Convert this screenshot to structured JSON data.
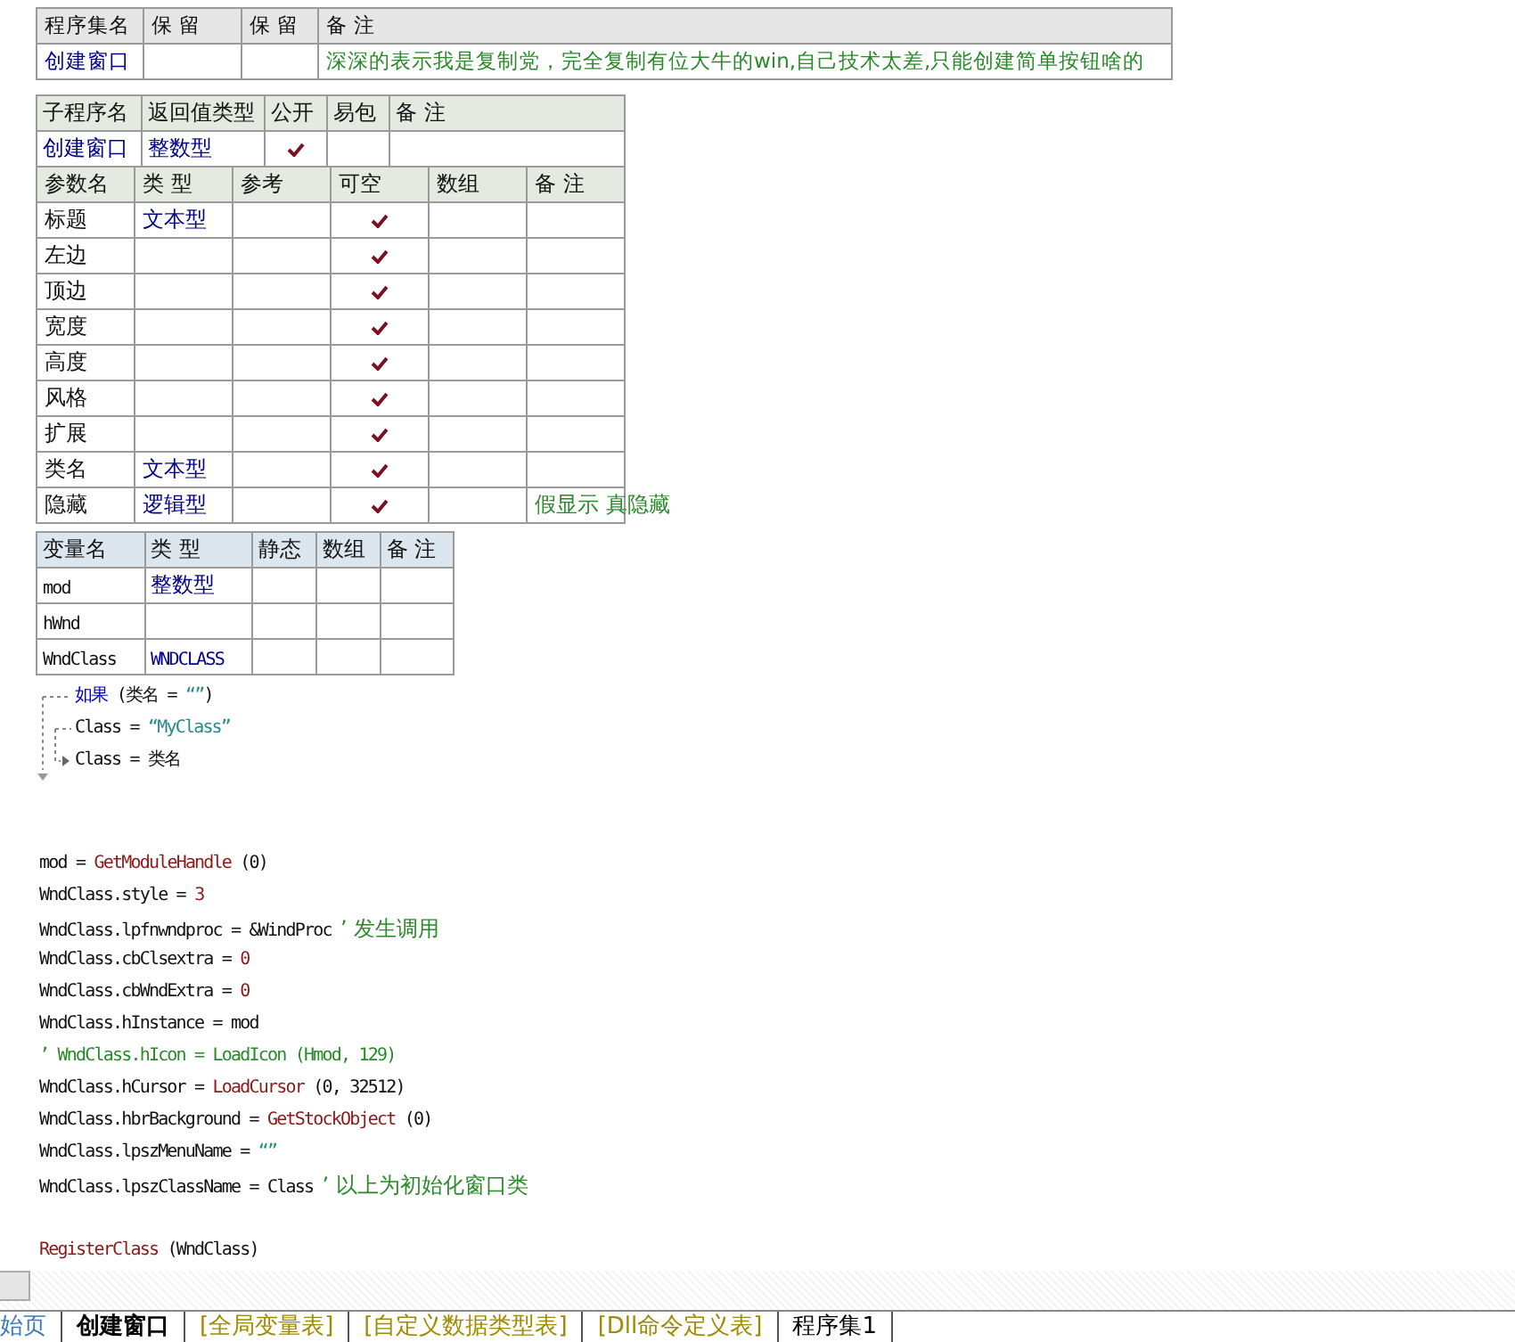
{
  "assembly_table": {
    "columns": [
      "程序集名",
      "保 留",
      "保 留",
      "备 注"
    ],
    "row": {
      "name": "创建窗口",
      "note": "深深的表示我是复制党，完全复制有位大牛的win,自己技术太差,只能创建简单按钮啥的"
    }
  },
  "subroutine_table": {
    "columns": [
      "子程序名",
      "返回值类型",
      "公开",
      "易包",
      "备 注"
    ],
    "row": {
      "name": "创建窗口",
      "return_type": "整数型",
      "public": true
    },
    "param_columns": [
      "参数名",
      "类 型",
      "参考",
      "可空",
      "数组",
      "备 注"
    ],
    "params": [
      {
        "name": "标题",
        "type": "文本型",
        "nullable": true
      },
      {
        "name": "左边",
        "nullable": true
      },
      {
        "name": "顶边",
        "nullable": true
      },
      {
        "name": "宽度",
        "nullable": true
      },
      {
        "name": "高度",
        "nullable": true
      },
      {
        "name": "风格",
        "nullable": true
      },
      {
        "name": "扩展",
        "nullable": true
      },
      {
        "name": "类名",
        "type": "文本型",
        "nullable": true
      },
      {
        "name": "隐藏",
        "type": "逻辑型",
        "nullable": true,
        "note": "假显示 真隐藏"
      }
    ]
  },
  "variable_table": {
    "columns": [
      "变量名",
      "类 型",
      "静态",
      "数组",
      "备 注"
    ],
    "rows": [
      {
        "name": "mod",
        "type": "整数型"
      },
      {
        "name": "hWnd"
      },
      {
        "name": "WndClass",
        "type": "WNDCLASS"
      }
    ]
  },
  "flow_block": [
    [
      {
        "kind": "keyword",
        "text": "如果"
      },
      {
        "kind": "plain",
        "text": " (类名 = "
      },
      {
        "kind": "str",
        "text": "“”"
      },
      {
        "kind": "plain",
        "text": ")"
      }
    ],
    [
      {
        "kind": "plain",
        "text": "Class = "
      },
      {
        "kind": "str",
        "text": "“MyClass”"
      }
    ],
    [
      {
        "kind": "plain",
        "text": "Class = 类名"
      }
    ]
  ],
  "code_blocks": [
    [
      [
        {
          "kind": "plain",
          "text": "mod = "
        },
        {
          "kind": "func",
          "text": "GetModuleHandle"
        },
        {
          "kind": "plain",
          "text": " (0)"
        }
      ],
      [
        {
          "kind": "plain",
          "text": "WndClass.style = "
        },
        {
          "kind": "func",
          "text": "3"
        }
      ],
      [
        {
          "kind": "plain",
          "text": "WndClass.lpfnwndproc = &WindProc "
        },
        {
          "kind": "comment",
          "text": "’ 发生调用"
        }
      ],
      [
        {
          "kind": "plain",
          "text": "WndClass.cbClsextra = "
        },
        {
          "kind": "func",
          "text": "0"
        }
      ],
      [
        {
          "kind": "plain",
          "text": "WndClass.cbWndExtra = "
        },
        {
          "kind": "func",
          "text": "0"
        }
      ],
      [
        {
          "kind": "plain",
          "text": "WndClass.hInstance = mod"
        }
      ],
      [
        {
          "kind": "comment",
          "text": "’ WndClass.hIcon = LoadIcon (Hmod, 129)"
        }
      ],
      [
        {
          "kind": "plain",
          "text": "WndClass.hCursor = "
        },
        {
          "kind": "func",
          "text": "LoadCursor"
        },
        {
          "kind": "plain",
          "text": " (0, 32512)"
        }
      ],
      [
        {
          "kind": "plain",
          "text": "WndClass.hbrBackground = "
        },
        {
          "kind": "func",
          "text": "GetStockObject"
        },
        {
          "kind": "plain",
          "text": " (0)"
        }
      ],
      [
        {
          "kind": "plain",
          "text": "WndClass.lpszMenuName = "
        },
        {
          "kind": "str",
          "text": "“”"
        }
      ],
      [
        {
          "kind": "plain",
          "text": "WndClass.lpszClassName = Class "
        },
        {
          "kind": "comment",
          "text": "’ 以上为初始化窗口类"
        }
      ]
    ],
    [
      [
        {
          "kind": "func",
          "text": "RegisterClass"
        },
        {
          "kind": "plain",
          "text": " (WndClass)"
        }
      ]
    ]
  ],
  "tabs": [
    {
      "label": "始页",
      "kind": "page",
      "selected": false
    },
    {
      "label": "创建窗口",
      "kind": "code",
      "selected": true
    },
    {
      "label": "[全局变量表]",
      "kind": "table",
      "selected": false
    },
    {
      "label": "[自定义数据类型表]",
      "kind": "table",
      "selected": false
    },
    {
      "label": "[Dll命令定义表]",
      "kind": "table",
      "selected": false
    },
    {
      "label": "程序集1",
      "kind": "code",
      "selected": false
    }
  ]
}
